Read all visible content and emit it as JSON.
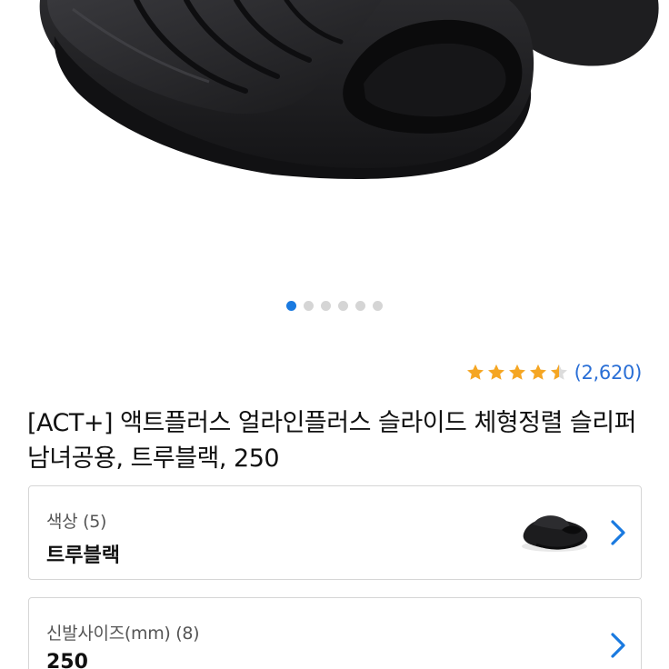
{
  "colors": {
    "accent": "#1a7ae0",
    "star": "#f5a623",
    "review_count": "#2a6fd6",
    "product": "#1c1c1e"
  },
  "image": {
    "description_icon": "black-slide-sandal-photo",
    "carousel_count": 6,
    "carousel_active_index": 0
  },
  "rating": {
    "value": 4.5,
    "max": 5,
    "count": "(2,620)"
  },
  "product": {
    "title": "[ACT+] 액트플러스 얼라인플러스 슬라이드 체형정렬 슬리퍼 남녀공용, 트루블랙, 250"
  },
  "options": {
    "color": {
      "label": "색상 (5)",
      "value": "트루블랙"
    },
    "size": {
      "label": "신발사이즈(mm) (8)",
      "value": "250"
    }
  }
}
